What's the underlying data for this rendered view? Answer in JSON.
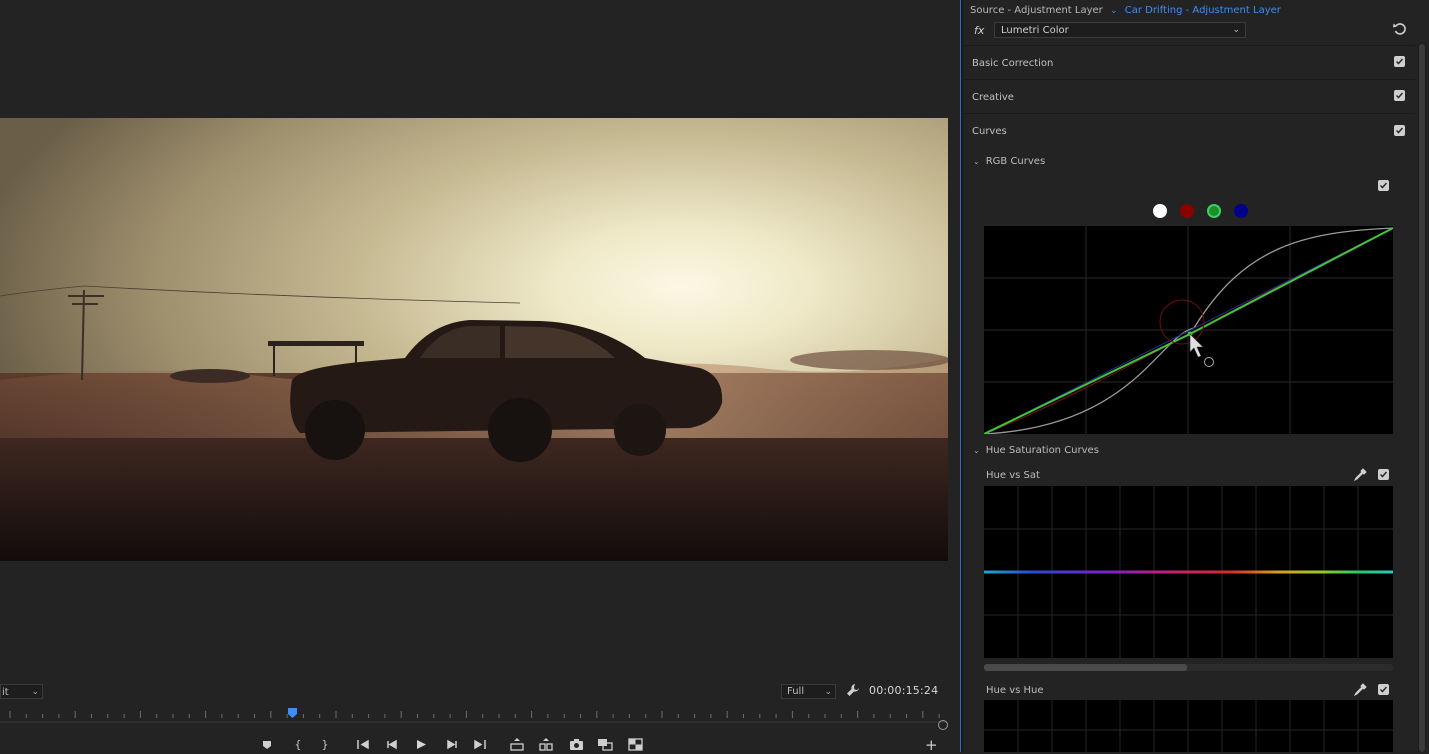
{
  "monitor": {
    "fit_label": "it",
    "quality_label": "Full",
    "timecode": "00:00:15:24",
    "transport": [
      {
        "name": "add-marker-button",
        "icon": "marker-icon"
      },
      {
        "name": "mark-in-button",
        "label": "{"
      },
      {
        "name": "mark-out-button",
        "label": "}"
      },
      {
        "name": "go-to-in-button",
        "icon": "go-to-in-icon"
      },
      {
        "name": "step-back-button",
        "icon": "step-back-icon"
      },
      {
        "name": "play-button",
        "icon": "play-icon"
      },
      {
        "name": "step-forward-button",
        "icon": "step-forward-icon"
      },
      {
        "name": "go-to-out-button",
        "icon": "go-to-out-icon"
      },
      {
        "name": "lift-button",
        "icon": "lift-icon"
      },
      {
        "name": "extract-button",
        "icon": "extract-icon"
      },
      {
        "name": "export-frame-button",
        "icon": "camera-icon"
      },
      {
        "name": "comparison-view-button",
        "icon": "comparison-icon"
      },
      {
        "name": "toggle-proxies-button",
        "icon": "proxy-icon"
      }
    ],
    "add_label": "+"
  },
  "panel": {
    "source_tab": "Source - Adjustment Layer",
    "clip_tab": "Car Drifting - Adjustment Layer",
    "fx_label": "fx",
    "effect_name": "Lumetri Color",
    "sections": [
      {
        "label": "Basic Correction",
        "checked": true
      },
      {
        "label": "Creative",
        "checked": true
      },
      {
        "label": "Curves",
        "checked": true
      }
    ],
    "rgb_curves_label": "RGB Curves",
    "hue_sat_curves_label": "Hue Saturation Curves",
    "hue_vs_sat_label": "Hue vs Sat",
    "hue_vs_hue_label": "Hue vs Hue",
    "channel_colors": {
      "white": "#ffffff",
      "red": "#8b0000",
      "green": "#1a8f2a",
      "blue": "#00008b"
    },
    "selected_channel": "green"
  }
}
